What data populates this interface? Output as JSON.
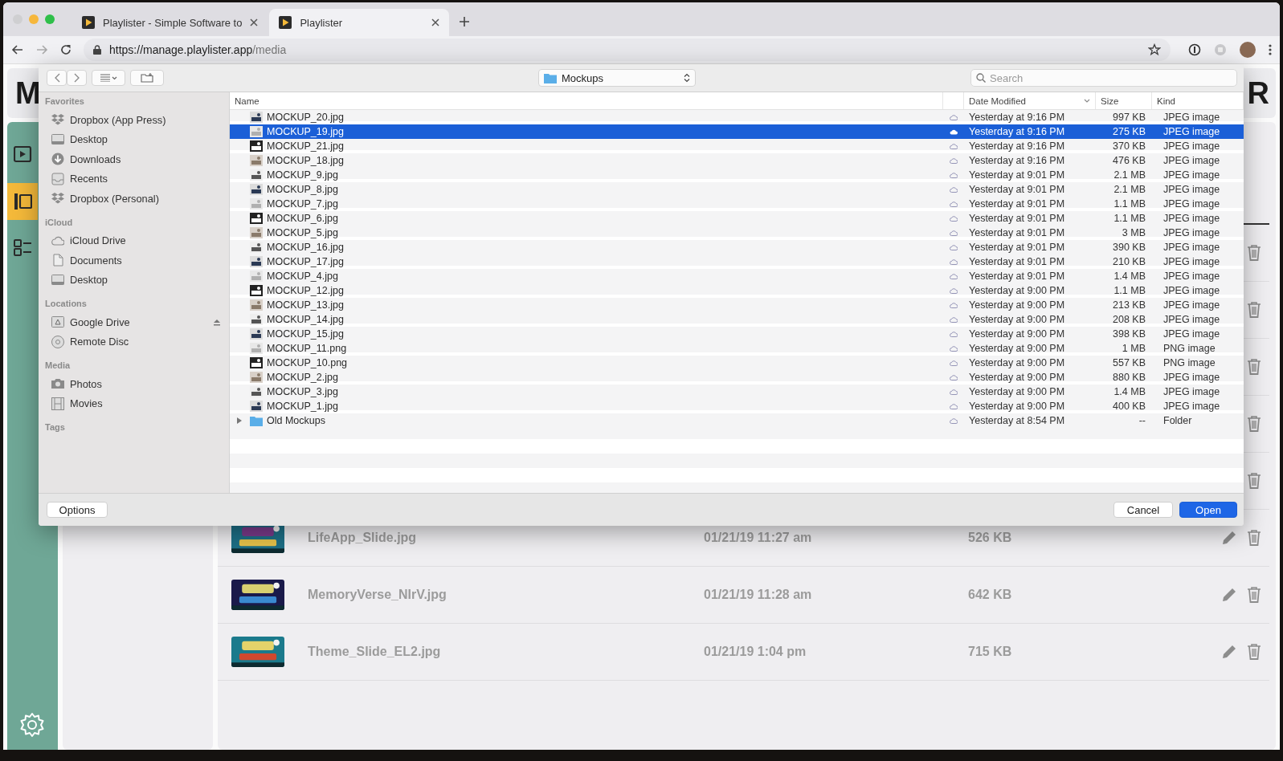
{
  "browser": {
    "tabs": [
      {
        "title": "Playlister - Simple Software to",
        "selected": false
      },
      {
        "title": "Playlister",
        "selected": true
      }
    ],
    "url_host": "https://manage.playlister.app",
    "url_path": "/media"
  },
  "app": {
    "header_left": "M",
    "header_right": "R",
    "rail": [
      {
        "kind": "play",
        "selected": false
      },
      {
        "kind": "slides",
        "selected": true
      },
      {
        "kind": "list",
        "selected": false
      }
    ],
    "media_rows": [
      {
        "name": "LifeApp_Slide.jpg",
        "date": "01/21/19 11:27 am",
        "size": "526 KB"
      },
      {
        "name": "MemoryVerse_NIrV.jpg",
        "date": "01/21/19 11:28 am",
        "size": "642 KB"
      },
      {
        "name": "Theme_Slide_EL2.jpg",
        "date": "01/21/19 1:04 pm",
        "size": "715 KB"
      }
    ]
  },
  "dialog": {
    "location": "Mockups",
    "search": {
      "placeholder": "Search"
    },
    "sidebar": [
      {
        "title": "Favorites",
        "items": [
          {
            "label": "Dropbox (App Press)",
            "kind": "dropbox",
            "ejectable": false
          },
          {
            "label": "Desktop",
            "kind": "desktop",
            "ejectable": false
          },
          {
            "label": "Downloads",
            "kind": "downloads",
            "ejectable": false
          },
          {
            "label": "Recents",
            "kind": "recents",
            "ejectable": false
          },
          {
            "label": "Dropbox (Personal)",
            "kind": "dropbox",
            "ejectable": false
          }
        ]
      },
      {
        "title": "iCloud",
        "items": [
          {
            "label": "iCloud Drive",
            "kind": "cloud",
            "ejectable": false
          },
          {
            "label": "Documents",
            "kind": "documents",
            "ejectable": false
          },
          {
            "label": "Desktop",
            "kind": "desktop",
            "ejectable": false
          }
        ]
      },
      {
        "title": "Locations",
        "items": [
          {
            "label": "Google Drive",
            "kind": "drive",
            "ejectable": true
          },
          {
            "label": "Remote Disc",
            "kind": "disc",
            "ejectable": false
          }
        ]
      },
      {
        "title": "Media",
        "items": [
          {
            "label": "Photos",
            "kind": "photos",
            "ejectable": false
          },
          {
            "label": "Movies",
            "kind": "movies",
            "ejectable": false
          }
        ]
      },
      {
        "title": "Tags"
      }
    ],
    "columns": [
      {
        "label": "Name",
        "sorted": false
      },
      {
        "label": "Date Modified",
        "sorted": true
      },
      {
        "label": "Size",
        "sorted": false
      },
      {
        "label": "Kind",
        "sorted": false
      }
    ],
    "files": [
      {
        "name": "MOCKUP_20.jpg",
        "date": "Yesterday at 9:16 PM",
        "size": "997 KB",
        "kind_label": "JPEG image",
        "selected": false
      },
      {
        "name": "MOCKUP_19.jpg",
        "date": "Yesterday at 9:16 PM",
        "size": "275 KB",
        "kind_label": "JPEG image",
        "selected": true
      },
      {
        "name": "MOCKUP_21.jpg",
        "date": "Yesterday at 9:16 PM",
        "size": "370 KB",
        "kind_label": "JPEG image",
        "selected": false
      },
      {
        "name": "MOCKUP_18.jpg",
        "date": "Yesterday at 9:16 PM",
        "size": "476 KB",
        "kind_label": "JPEG image",
        "selected": false
      },
      {
        "name": "MOCKUP_9.jpg",
        "date": "Yesterday at 9:01 PM",
        "size": "2.1 MB",
        "kind_label": "JPEG image",
        "selected": false
      },
      {
        "name": "MOCKUP_8.jpg",
        "date": "Yesterday at 9:01 PM",
        "size": "2.1 MB",
        "kind_label": "JPEG image",
        "selected": false
      },
      {
        "name": "MOCKUP_7.jpg",
        "date": "Yesterday at 9:01 PM",
        "size": "1.1 MB",
        "kind_label": "JPEG image",
        "selected": false
      },
      {
        "name": "MOCKUP_6.jpg",
        "date": "Yesterday at 9:01 PM",
        "size": "1.1 MB",
        "kind_label": "JPEG image",
        "selected": false
      },
      {
        "name": "MOCKUP_5.jpg",
        "date": "Yesterday at 9:01 PM",
        "size": "3 MB",
        "kind_label": "JPEG image",
        "selected": false
      },
      {
        "name": "MOCKUP_16.jpg",
        "date": "Yesterday at 9:01 PM",
        "size": "390 KB",
        "kind_label": "JPEG image",
        "selected": false
      },
      {
        "name": "MOCKUP_17.jpg",
        "date": "Yesterday at 9:01 PM",
        "size": "210 KB",
        "kind_label": "JPEG image",
        "selected": false
      },
      {
        "name": "MOCKUP_4.jpg",
        "date": "Yesterday at 9:01 PM",
        "size": "1.4 MB",
        "kind_label": "JPEG image",
        "selected": false
      },
      {
        "name": "MOCKUP_12.jpg",
        "date": "Yesterday at 9:00 PM",
        "size": "1.1 MB",
        "kind_label": "JPEG image",
        "selected": false
      },
      {
        "name": "MOCKUP_13.jpg",
        "date": "Yesterday at 9:00 PM",
        "size": "213 KB",
        "kind_label": "JPEG image",
        "selected": false
      },
      {
        "name": "MOCKUP_14.jpg",
        "date": "Yesterday at 9:00 PM",
        "size": "208 KB",
        "kind_label": "JPEG image",
        "selected": false
      },
      {
        "name": "MOCKUP_15.jpg",
        "date": "Yesterday at 9:00 PM",
        "size": "398 KB",
        "kind_label": "JPEG image",
        "selected": false
      },
      {
        "name": "MOCKUP_11.png",
        "date": "Yesterday at 9:00 PM",
        "size": "1 MB",
        "kind_label": "PNG image",
        "selected": false
      },
      {
        "name": "MOCKUP_10.png",
        "date": "Yesterday at 9:00 PM",
        "size": "557 KB",
        "kind_label": "PNG image",
        "selected": false
      },
      {
        "name": "MOCKUP_2.jpg",
        "date": "Yesterday at 9:00 PM",
        "size": "880 KB",
        "kind_label": "JPEG image",
        "selected": false
      },
      {
        "name": "MOCKUP_3.jpg",
        "date": "Yesterday at 9:00 PM",
        "size": "1.4 MB",
        "kind_label": "JPEG image",
        "selected": false
      },
      {
        "name": "MOCKUP_1.jpg",
        "date": "Yesterday at 9:00 PM",
        "size": "400 KB",
        "kind_label": "JPEG image",
        "selected": false
      },
      {
        "name": "Old Mockups",
        "date": "Yesterday at 8:54 PM",
        "size": "--",
        "kind_label": "Folder",
        "kind": "folder",
        "expanded": false,
        "selected": false
      }
    ],
    "buttons": {
      "options": "Options",
      "cancel": "Cancel",
      "open": "Open"
    }
  }
}
